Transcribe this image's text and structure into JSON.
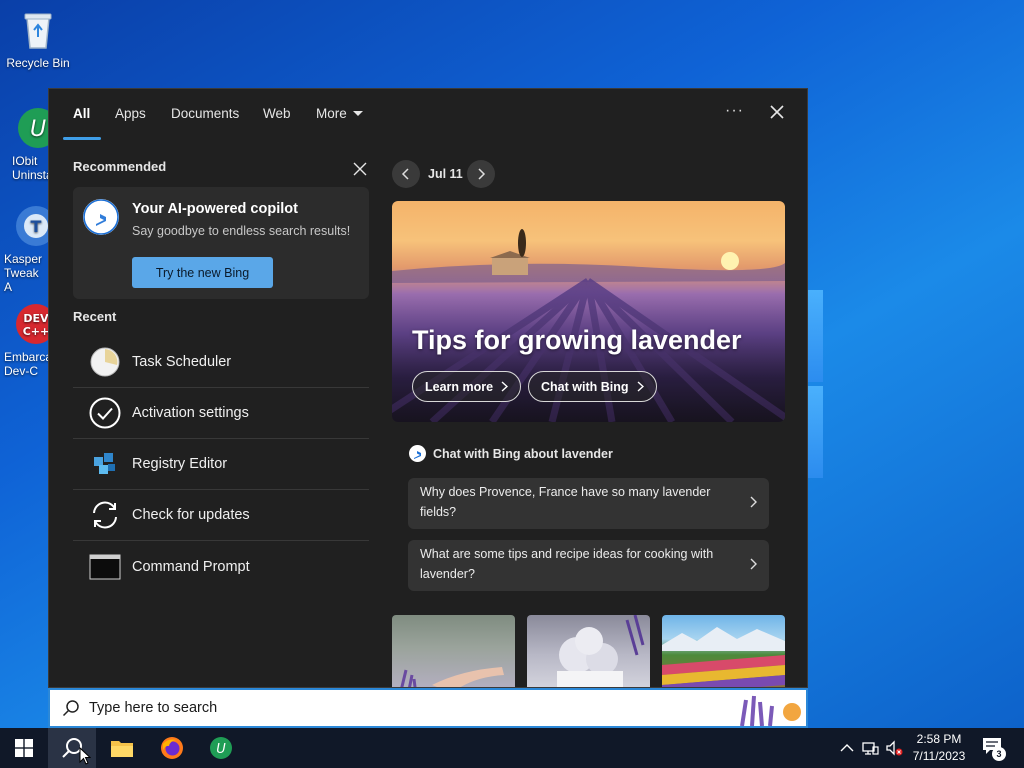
{
  "desktop": {
    "icons": [
      {
        "label": "Recycle Bin"
      },
      {
        "label": "IObit Uninsta"
      },
      {
        "label": "Kasper Tweak A"
      },
      {
        "label": "Embarca Dev-C"
      }
    ]
  },
  "search_panel": {
    "tabs": [
      {
        "label": "All"
      },
      {
        "label": "Apps"
      },
      {
        "label": "Documents"
      },
      {
        "label": "Web"
      },
      {
        "label": "More"
      }
    ],
    "more_options_icon": "ellipsis-icon",
    "recommended": {
      "title": "Recommended",
      "card_title": "Your AI-powered copilot",
      "card_subtitle": "Say goodbye to endless search results!",
      "button_label": "Try the new Bing"
    },
    "recent": {
      "title": "Recent",
      "items": [
        {
          "label": "Task Scheduler",
          "icon": "task-scheduler-icon"
        },
        {
          "label": "Activation settings",
          "icon": "check-circle-icon"
        },
        {
          "label": "Registry Editor",
          "icon": "registry-editor-icon"
        },
        {
          "label": "Check for updates",
          "icon": "sync-icon"
        },
        {
          "label": "Command Prompt",
          "icon": "command-prompt-icon"
        }
      ]
    },
    "highlights": {
      "date": "Jul 11",
      "hero_title": "Tips for growing lavender",
      "learn_more": "Learn more",
      "chat_with_bing": "Chat with Bing",
      "chat_heading": "Chat with Bing about lavender",
      "questions": [
        "Why does Provence, France have so many lavender fields?",
        "What are some tips and recipe ideas for cooking with lavender?"
      ]
    }
  },
  "searchbar": {
    "placeholder": "Type here to search"
  },
  "taskbar": {
    "time": "2:58 PM",
    "date": "7/11/2023",
    "notification_count": "3"
  }
}
